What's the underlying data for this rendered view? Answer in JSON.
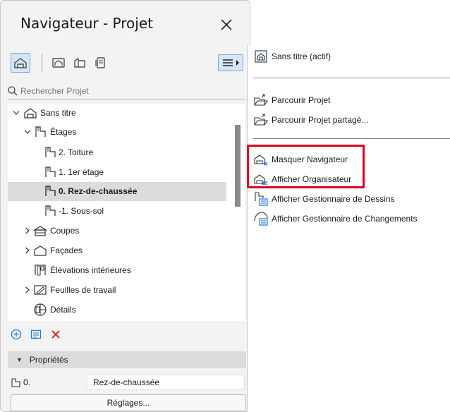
{
  "navigator": {
    "title": "Navigateur - Projet",
    "search_placeholder": "Rechercher Projet",
    "tree": [
      {
        "label": "Sans titre",
        "level": 0,
        "expanded": true,
        "icon": "project-icon"
      },
      {
        "label": "Étages",
        "level": 1,
        "expanded": true,
        "icon": "stories-icon"
      },
      {
        "label": "2. Toiture",
        "level": 2,
        "icon": "story-icon"
      },
      {
        "label": "1. 1er étage",
        "level": 2,
        "icon": "story-icon"
      },
      {
        "label": "0. Rez-de-chaussée",
        "level": 2,
        "icon": "story-icon",
        "selected": true
      },
      {
        "label": "-1. Sous-sol",
        "level": 2,
        "icon": "story-icon"
      },
      {
        "label": "Coupes",
        "level": 1,
        "expanded": false,
        "icon": "sections-icon"
      },
      {
        "label": "Façades",
        "level": 1,
        "expanded": false,
        "icon": "elevations-icon"
      },
      {
        "label": "Élévations intérieures",
        "level": 1,
        "icon": "interior-elevations-icon"
      },
      {
        "label": "Feuilles de travail",
        "level": 1,
        "expanded": false,
        "icon": "worksheets-icon"
      },
      {
        "label": "Détails",
        "level": 1,
        "icon": "details-icon"
      }
    ],
    "properties": {
      "header": "Propriétés",
      "number": "0.",
      "value": "Rez-de-chaussée",
      "settings_button": "Réglages..."
    }
  },
  "menu": {
    "items": [
      {
        "label": "Sans titre (actif)",
        "icon": "project-file-icon"
      },
      {
        "label": "Parcourir Projet",
        "icon": "browse-project-icon"
      },
      {
        "label": "Parcourir Projet partagé...",
        "icon": "browse-shared-icon"
      },
      {
        "label": "Masquer Navigateur",
        "icon": "hide-navigator-icon"
      },
      {
        "label": "Afficher Organisateur",
        "icon": "organizer-icon"
      },
      {
        "label": "Afficher Gestionnaire de Dessins",
        "icon": "drawing-manager-icon"
      },
      {
        "label": "Afficher Gestionnaire de Changements",
        "icon": "change-manager-icon"
      }
    ]
  },
  "colors": {
    "accent": "#1e7ad6",
    "delete": "#e0301e",
    "highlight": "#e0001b",
    "selected_row": "#dcdcdc"
  }
}
